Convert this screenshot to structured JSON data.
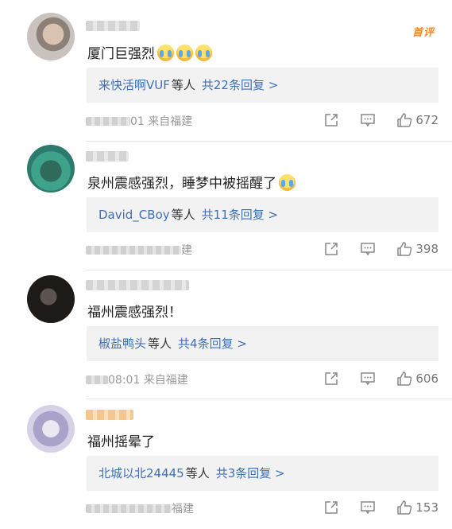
{
  "hot_label": "首评",
  "comments": [
    {
      "text": "厦门巨强烈",
      "reply_who": "来快活啊VUF",
      "reply_etc": "等人",
      "reply_count": "共22条回复 >",
      "time_visible": "01 来自福建",
      "likes": "672"
    },
    {
      "text": "泉州震感强烈，睡梦中被摇醒了",
      "reply_who": "David_CBoy",
      "reply_etc": "等人",
      "reply_count": "共11条回复 >",
      "time_visible": "建",
      "likes": "398"
    },
    {
      "text": "福州震感强烈！",
      "reply_who": "椒盐鸭头",
      "reply_etc": "等人",
      "reply_count": "共4条回复 >",
      "time_visible": "08:01 来自福建",
      "likes": "606"
    },
    {
      "text": "福州摇晕了",
      "reply_who": "北城以北24445",
      "reply_etc": "等人",
      "reply_count": "共3条回复 >",
      "time_visible": "福建",
      "likes": "153"
    }
  ]
}
